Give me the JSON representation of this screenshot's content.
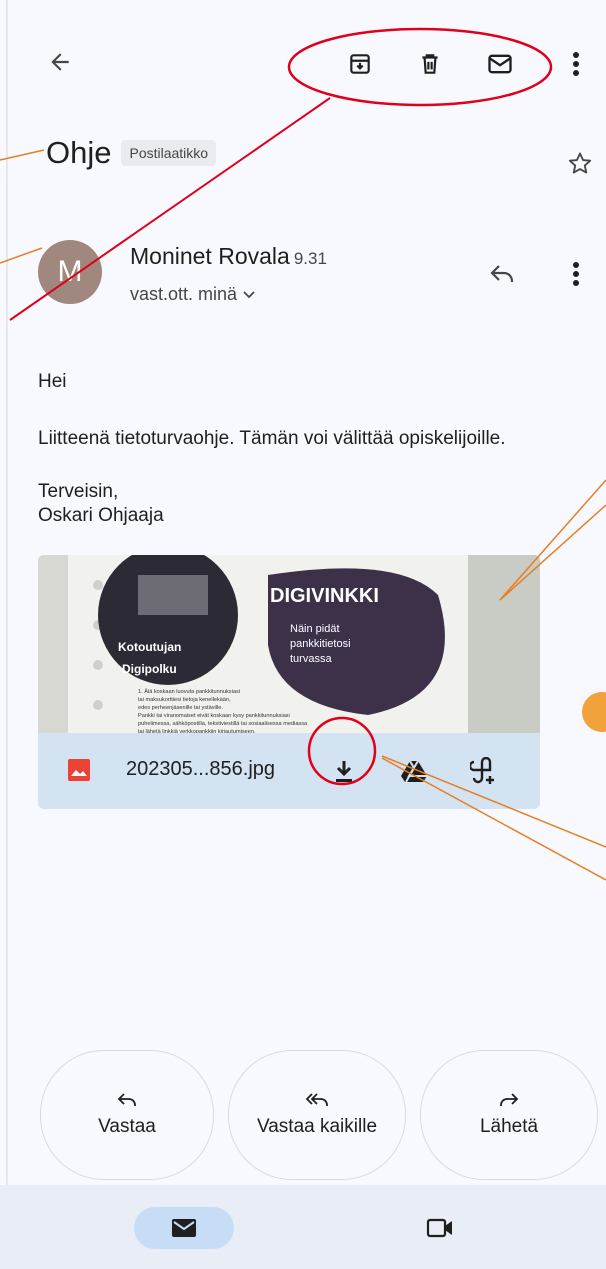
{
  "header": {
    "back_icon": "arrow-left-icon",
    "archive_icon": "archive-icon",
    "delete_icon": "trash-icon",
    "mark_unread_icon": "mail-icon",
    "more_icon": "more-vert-icon"
  },
  "subject": {
    "title": "Ohje",
    "label": "Postilaatikko"
  },
  "message": {
    "avatar_letter": "M",
    "sender": "Moninet Rovala",
    "time": "9.31",
    "recipients": "vast.ott. minä",
    "greeting": "Hei",
    "body": "Liitteenä tietoturvaohje. Tämän voi välittää opiskelijoille.",
    "signoff": "Terveisin,",
    "signature": "Oskari Ohjaaja"
  },
  "attachment": {
    "preview": {
      "left_badge_1": "Kotoutujan",
      "left_badge_2": "Digipolku",
      "headline": "DIGIVINKKI",
      "subtitle_1": "Näin pidät",
      "subtitle_2": "pankkitietosi",
      "subtitle_3": "turvassa",
      "fine_print": [
        "1. Älä koskaan luovuta pankkitunnuksiasi",
        "tai maksukorttiesi tietoja kenellekään,",
        "edes perheenjäsenille tai ystäville.",
        "Pankki tai viranomaiset eivät koskaan kysy pankkitunnuksiasi",
        "puhelimessa, sähköpostilla, tekstiviestillä tai sosiaalisessa mediassa",
        "tai lähetä linkkiä verkkopankkiin kirjautumiseen."
      ]
    },
    "filename": "202305...856.jpg"
  },
  "actions": {
    "reply": "Vastaa",
    "reply_all": "Vastaa kaikille",
    "forward": "Lähetä"
  },
  "colors": {
    "annotation_red": "#e0001b",
    "annotation_orange": "#e67e22",
    "nav_active": "#c7ddf5"
  }
}
